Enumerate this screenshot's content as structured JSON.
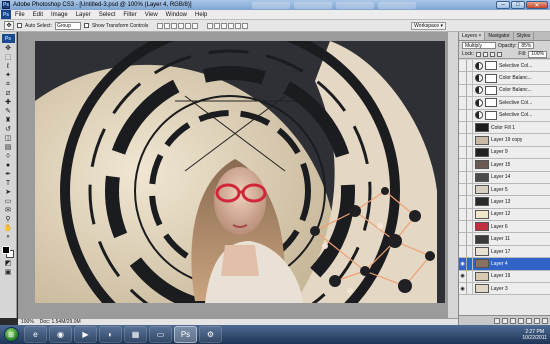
{
  "window": {
    "title": "Adobe Photoshop CS3 - [Untitled-3.psd @ 100% (Layer 4, RGB/8)]",
    "app_badge": "Ps",
    "minimize": "–",
    "maximize": "□",
    "close": "✕"
  },
  "menu": [
    "File",
    "Edit",
    "Image",
    "Layer",
    "Select",
    "Filter",
    "View",
    "Window",
    "Help"
  ],
  "options": {
    "auto_select_label": "Auto Select:",
    "auto_select_value": "Group",
    "transform_label": "Show Transform Controls",
    "workspace_label": "Workspace ▾"
  },
  "status": {
    "zoom": "100%",
    "doc": "Doc: 1.54M/29.0M"
  },
  "panel": {
    "tabs": [
      "Layers ×",
      "Navigator",
      "Styles"
    ],
    "blend_mode": "Multiply",
    "opacity_label": "Opacity:",
    "opacity_value": "85%",
    "lock_label": "Lock:",
    "fill_label": "Fill:",
    "fill_value": "100%"
  },
  "layers": [
    {
      "name": "Selective Col...",
      "type": "adj",
      "visible": false,
      "thumb": "#ffffff"
    },
    {
      "name": "Color Balanc...",
      "type": "adj",
      "visible": false,
      "thumb": "#ffffff"
    },
    {
      "name": "Color Balanc...",
      "type": "adj",
      "visible": false,
      "thumb": "#ffffff"
    },
    {
      "name": "Selective Col...",
      "type": "adj",
      "visible": false,
      "thumb": "#ffffff"
    },
    {
      "name": "Selective Col...",
      "type": "adj",
      "visible": false,
      "thumb": "#ffffff"
    },
    {
      "name": "Color Fill 1",
      "type": "fill",
      "visible": false,
      "thumb": "#1b1b1b"
    },
    {
      "name": "Layer 19 copy",
      "type": "pixel",
      "visible": false,
      "thumb": "#c9b8a6"
    },
    {
      "name": "Layer 9",
      "type": "pixel",
      "visible": false,
      "thumb": "#222222"
    },
    {
      "name": "Layer 15",
      "type": "pixel",
      "visible": false,
      "thumb": "#6b5a52"
    },
    {
      "name": "Layer 14",
      "type": "pixel",
      "visible": false,
      "thumb": "#4a4a4a"
    },
    {
      "name": "Layer 5",
      "type": "pixel",
      "visible": false,
      "thumb": "#d8d0c0"
    },
    {
      "name": "Layer 13",
      "type": "pixel",
      "visible": false,
      "thumb": "#2a2a2a"
    },
    {
      "name": "Layer 12",
      "type": "pixel",
      "visible": false,
      "thumb": "#f0e8c8"
    },
    {
      "name": "Layer 6",
      "type": "pixel",
      "visible": false,
      "thumb": "#c03040"
    },
    {
      "name": "Layer 11",
      "type": "pixel",
      "visible": false,
      "thumb": "#3a3a3a"
    },
    {
      "name": "Layer 17",
      "type": "pixel",
      "visible": false,
      "thumb": "#e8e0d0"
    },
    {
      "name": "Layer 4",
      "type": "pixel",
      "visible": true,
      "selected": true,
      "thumb": "#8a7060"
    },
    {
      "name": "Layer 19",
      "type": "pixel",
      "visible": true,
      "thumb": "#d8c8b0"
    },
    {
      "name": "Layer 3",
      "type": "pixel",
      "visible": true,
      "thumb": "#e0d6c4"
    }
  ],
  "taskbar": {
    "start_glyph": "⊞",
    "apps": [
      {
        "icon": "ie-icon",
        "glyph": "e"
      },
      {
        "icon": "chrome-icon",
        "glyph": "◉"
      },
      {
        "icon": "media-player-icon",
        "glyph": "▶"
      },
      {
        "icon": "firefox-icon",
        "glyph": "◐"
      },
      {
        "icon": "calculator-icon",
        "glyph": "▦"
      },
      {
        "icon": "folder-icon",
        "glyph": "▭"
      },
      {
        "icon": "photoshop-icon",
        "glyph": "Ps",
        "active": true
      },
      {
        "icon": "app-icon",
        "glyph": "⚙"
      }
    ],
    "time": "2:27 PM",
    "date": "10/22/2011"
  },
  "colors": {
    "selected_layer": "#3264c8",
    "canvas_bg": "#2e3035",
    "cream_shape": "#e8dcc6"
  }
}
